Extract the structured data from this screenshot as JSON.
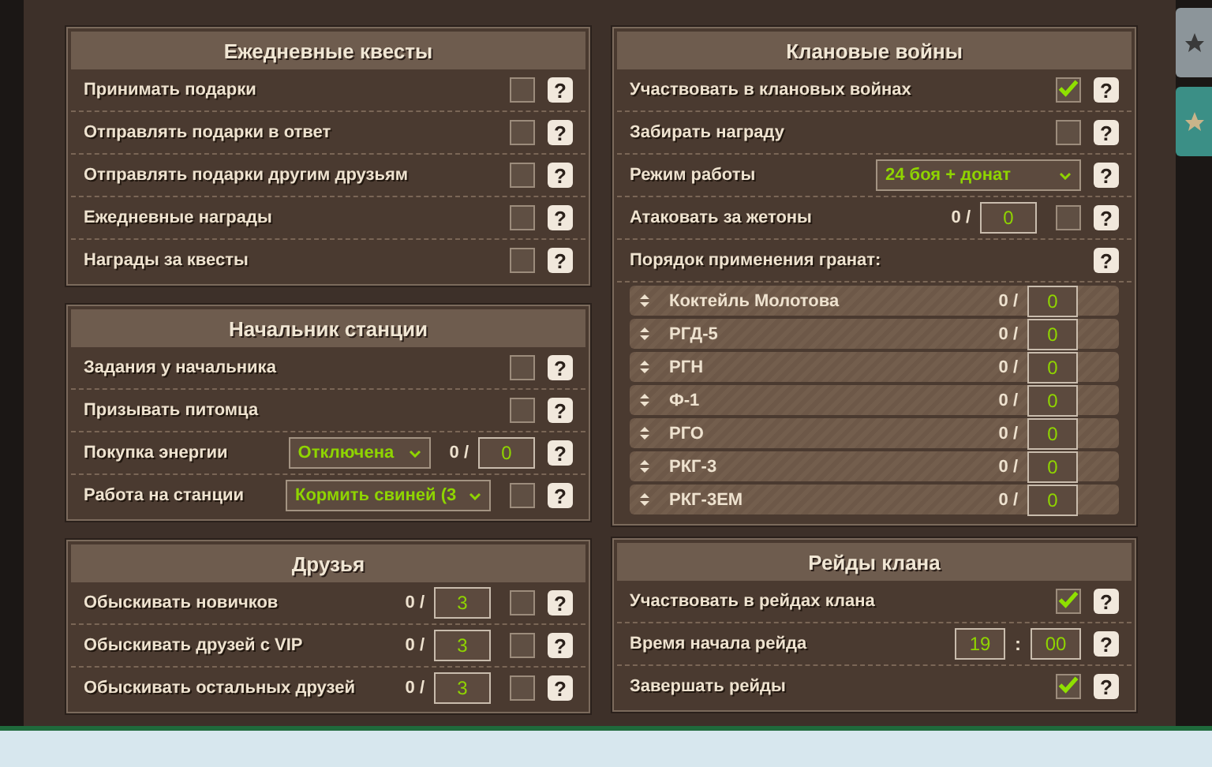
{
  "left_column": [
    {
      "title": "Ежедневные квесты",
      "rows": [
        {
          "kind": "check",
          "label": "Принимать подарки",
          "checked": false,
          "help": "?"
        },
        {
          "kind": "check",
          "label": "Отправлять подарки в ответ",
          "checked": false,
          "help": "?"
        },
        {
          "kind": "check",
          "label": "Отправлять подарки другим друзьям",
          "checked": false,
          "help": "?"
        },
        {
          "kind": "check",
          "label": "Ежедневные награды",
          "checked": false,
          "help": "?"
        },
        {
          "kind": "check",
          "label": "Награды за квесты",
          "checked": false,
          "help": "?"
        }
      ]
    },
    {
      "title": "Начальник станции",
      "rows": [
        {
          "kind": "check",
          "label": "Задания у начальника",
          "checked": false,
          "help": "?"
        },
        {
          "kind": "check",
          "label": "Призывать питомца",
          "checked": false,
          "help": "?"
        },
        {
          "kind": "select",
          "label": "Покупка энергии",
          "select": "Отключена",
          "count": "0 /",
          "value": "0",
          "help": "?"
        },
        {
          "kind": "wide_select",
          "label": "Работа на станции",
          "select": "Кормить свиней (3",
          "checked": false,
          "help": "?"
        }
      ]
    },
    {
      "title": "Друзья",
      "rows": [
        {
          "kind": "counter",
          "label": "Обыскивать новичков",
          "count": "0 /",
          "value": "3",
          "checked": false,
          "help": "?"
        },
        {
          "kind": "counter",
          "label": "Обыскивать друзей с VIP",
          "count": "0 /",
          "value": "3",
          "checked": false,
          "help": "?"
        },
        {
          "kind": "counter",
          "label": "Обыскивать остальных друзей",
          "count": "0 /",
          "value": "3",
          "checked": false,
          "help": "?"
        }
      ]
    }
  ],
  "clan_wars": {
    "title": "Клановые войны",
    "rows": [
      {
        "kind": "check",
        "label": "Участвовать в клановых войнах",
        "checked": true,
        "help": "?"
      },
      {
        "kind": "check",
        "label": "Забирать награду",
        "checked": false,
        "help": "?"
      },
      {
        "kind": "wide_select",
        "label": "Режим работы",
        "select": "24 боя + донат",
        "help": "?"
      },
      {
        "kind": "counter",
        "label": "Атаковать за жетоны",
        "count": "0 /",
        "value": "0",
        "checked": false,
        "help": "?"
      },
      {
        "kind": "heading",
        "label": "Порядок применения гранат:",
        "help": "?"
      }
    ],
    "grenades": [
      {
        "name": "Коктейль Молотова",
        "count": "0 /",
        "value": "0"
      },
      {
        "name": "РГД-5",
        "count": "0 /",
        "value": "0"
      },
      {
        "name": "РГН",
        "count": "0 /",
        "value": "0"
      },
      {
        "name": "Ф-1",
        "count": "0 /",
        "value": "0"
      },
      {
        "name": "РГО",
        "count": "0 /",
        "value": "0"
      },
      {
        "name": "РКГ-3",
        "count": "0 /",
        "value": "0"
      },
      {
        "name": "РКГ-3ЕМ",
        "count": "0 /",
        "value": "0"
      }
    ]
  },
  "clan_raids": {
    "title": "Рейды клана",
    "rows": [
      {
        "kind": "check",
        "label": "Участвовать в рейдах клана",
        "checked": true,
        "help": "?"
      },
      {
        "kind": "time",
        "label": "Время начала рейда",
        "hour": "19",
        "separator": ":",
        "minute": "00",
        "help": "?"
      },
      {
        "kind": "check",
        "label": "Завершать рейды",
        "checked": true,
        "help": "?"
      }
    ]
  }
}
